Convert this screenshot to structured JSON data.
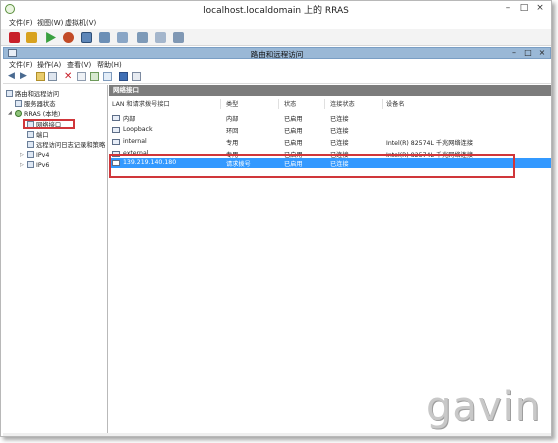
{
  "vm_window": {
    "title": "localhost.localdomain 上的 RRAS",
    "menu": [
      "文件(F)",
      "视图(W)",
      "虚拟机(V)"
    ],
    "controls": [
      "–",
      "□",
      "×"
    ]
  },
  "mmc_window": {
    "title": "路由和远程访问",
    "menu": [
      "文件(F)",
      "操作(A)",
      "查看(V)",
      "帮助(H)"
    ],
    "controls": [
      "–",
      "□",
      "×"
    ]
  },
  "tree": {
    "items": [
      {
        "label": "路由和远程访问"
      },
      {
        "label": "服务器状态"
      },
      {
        "label": "RRAS (本地)"
      },
      {
        "label": "网络接口"
      },
      {
        "label": "端口"
      },
      {
        "label": "远程访问日志记录和策略"
      },
      {
        "label": "IPv4"
      },
      {
        "label": "IPv6"
      }
    ]
  },
  "list": {
    "header": "网络接口",
    "columns": [
      "LAN 和请求拨号接口",
      "类型",
      "状态",
      "连接状态",
      "设备名"
    ],
    "rows": [
      {
        "name": "内部",
        "type": "内部",
        "status": "已启用",
        "conn": "已连接",
        "device": ""
      },
      {
        "name": "Loopback",
        "type": "环回",
        "status": "已启用",
        "conn": "已连接",
        "device": ""
      },
      {
        "name": "internal",
        "type": "专用",
        "status": "已启用",
        "conn": "已连接",
        "device": "Intel(R) 82574L 千兆网络连接"
      },
      {
        "name": "external",
        "type": "专用",
        "status": "已启用",
        "conn": "已连接",
        "device": "Intel(R) 82574L 千兆网络连接"
      },
      {
        "name": "139.219.140.180",
        "type": "请求拨号",
        "status": "已启用",
        "conn": "已连接",
        "device": ""
      }
    ]
  },
  "watermark": "gavin",
  "colors": {
    "selection": "#3399ff",
    "highlight_box": "#d0363a",
    "mmc_title": "#9ab8d6"
  }
}
